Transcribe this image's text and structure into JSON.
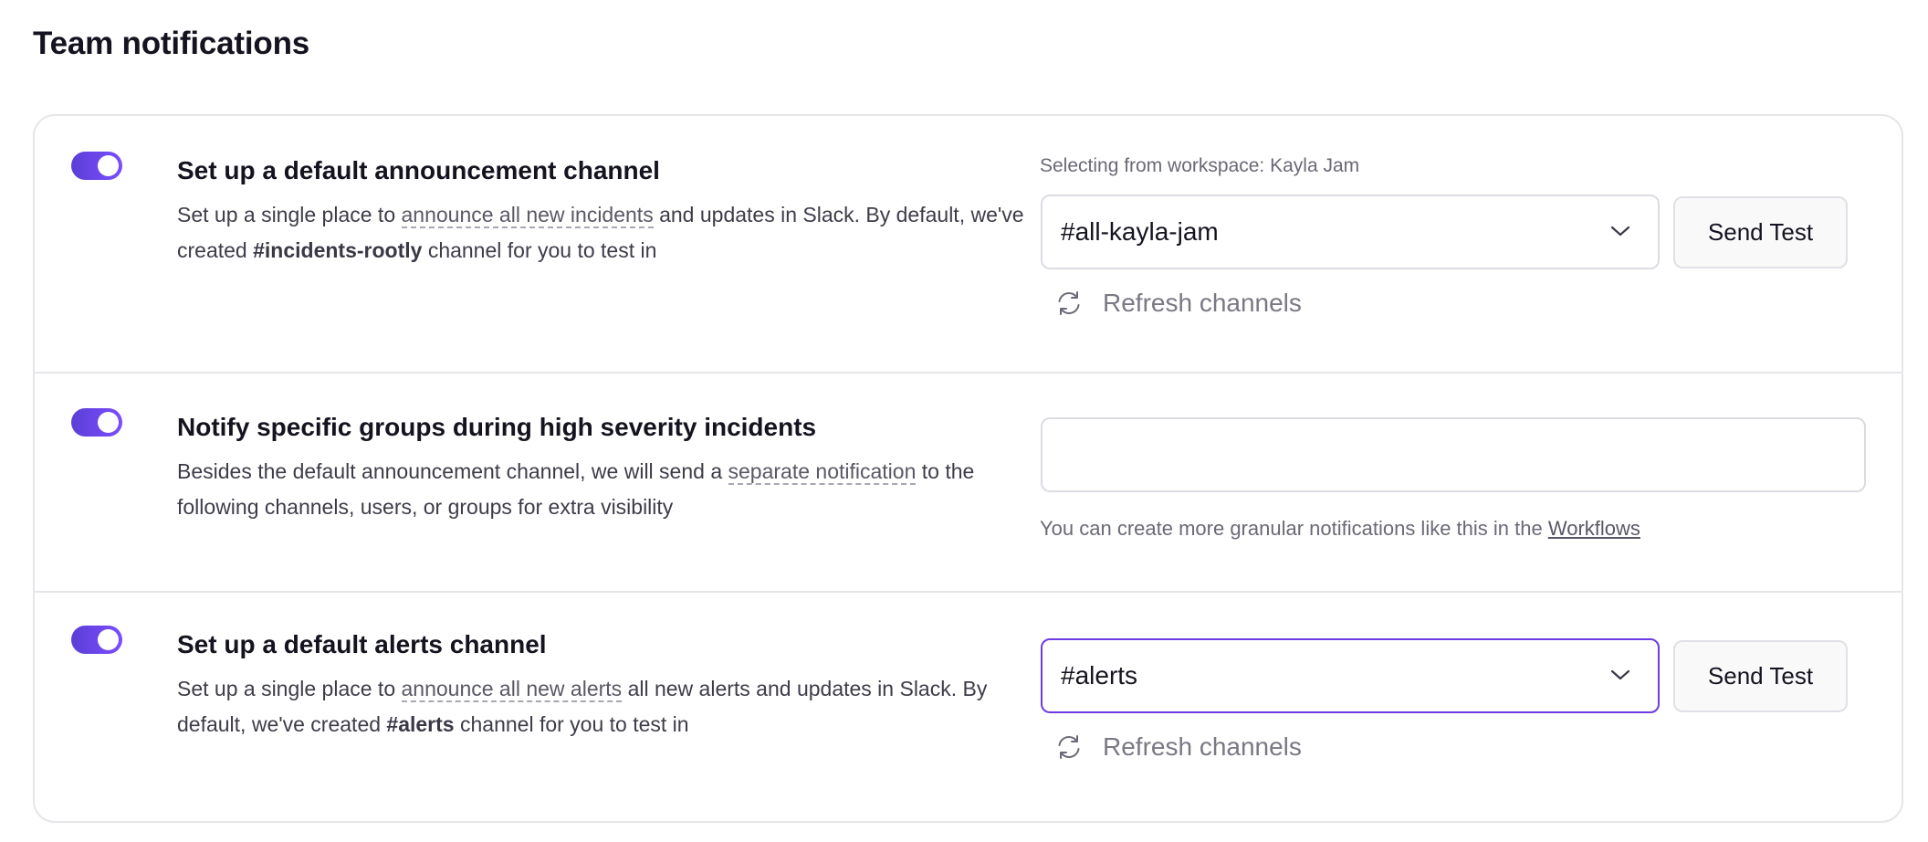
{
  "page": {
    "title": "Team notifications"
  },
  "rows": [
    {
      "enabled": true,
      "title": "Set up a default announcement channel",
      "desc_pre": "Set up a single place to",
      "desc_link": "announce all new incidents",
      "desc_mid": "and updates in Slack. By default, we've created",
      "desc_bold": "#incidents-rootly",
      "desc_post": "channel for you to test in",
      "workspace_label": "Selecting from workspace: Kayla Jam",
      "channel": "#all-kayla-jam",
      "send_test_label": "Send Test",
      "refresh_label": "Refresh channels"
    },
    {
      "enabled": true,
      "title": "Notify specific groups during high severity incidents",
      "desc_pre": "Besides the default announcement channel, we will send a",
      "desc_link": "separate notification",
      "desc_post": "to the following channels, users, or groups for extra visibility",
      "input_value": "",
      "hint_pre": "You can create more granular notifications like this in the",
      "hint_link": "Workflows"
    },
    {
      "enabled": true,
      "title": "Set up a default alerts channel",
      "desc_pre": "Set up a single place to",
      "desc_link": "announce all new alerts",
      "desc_mid": "all new alerts and updates in Slack. By default, we've created",
      "desc_bold": "#alerts",
      "desc_post": "channel for you to test in",
      "channel": "#alerts",
      "send_test_label": "Send Test",
      "refresh_label": "Refresh channels"
    }
  ],
  "icons": {
    "dropdown": "chevron-down-icon",
    "refresh": "refresh-icon"
  },
  "colors": {
    "toggle_on": "#6c3ce0",
    "active_border": "#6c3ce0",
    "text_primary": "#15131f",
    "text_muted": "#6b6977"
  }
}
